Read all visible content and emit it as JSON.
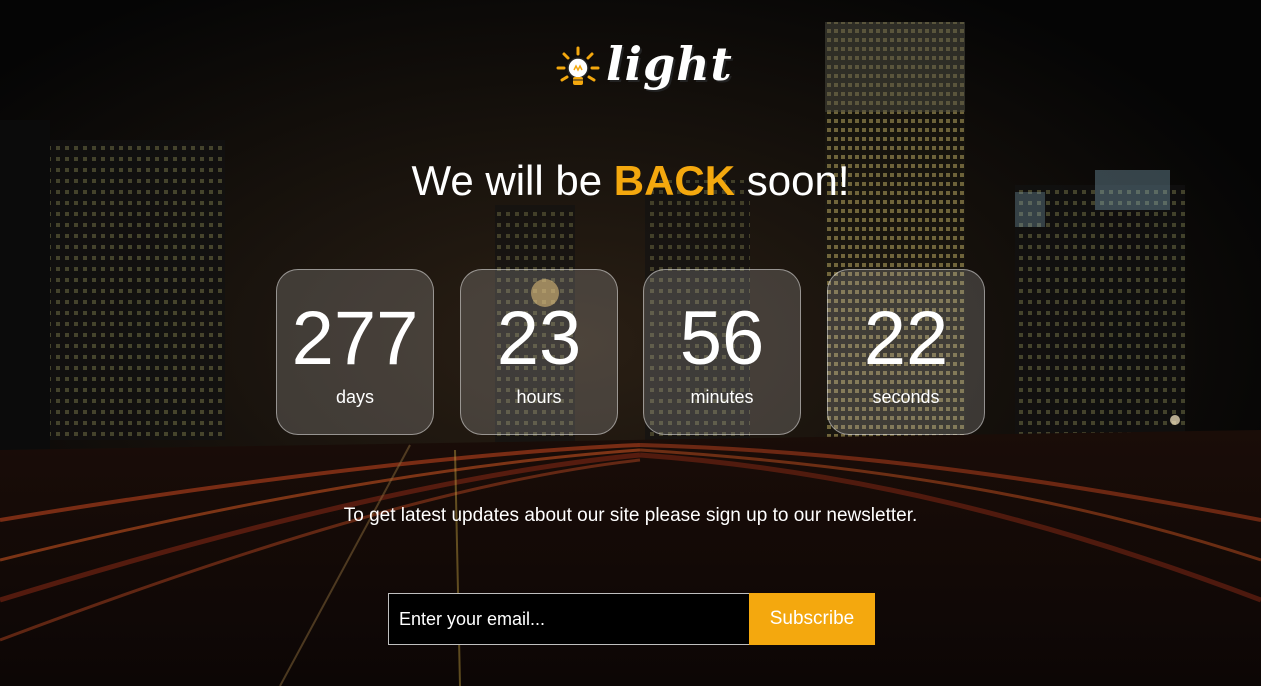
{
  "logo": {
    "text": "light",
    "icon": "lightbulb-icon"
  },
  "headline": {
    "before": "We will be ",
    "accent": "BACK",
    "after": " soon!"
  },
  "countdown": [
    {
      "value": "277",
      "label": "days"
    },
    {
      "value": "23",
      "label": "hours"
    },
    {
      "value": "56",
      "label": "minutes"
    },
    {
      "value": "22",
      "label": "seconds"
    }
  ],
  "newsletter": {
    "text": "To get latest updates about our site please sign up to our newsletter.",
    "email_placeholder": "Enter your email...",
    "email_value": "",
    "subscribe_label": "Subscribe"
  },
  "colors": {
    "accent": "#f4a80e",
    "background": "#050505",
    "text": "#ffffff"
  }
}
